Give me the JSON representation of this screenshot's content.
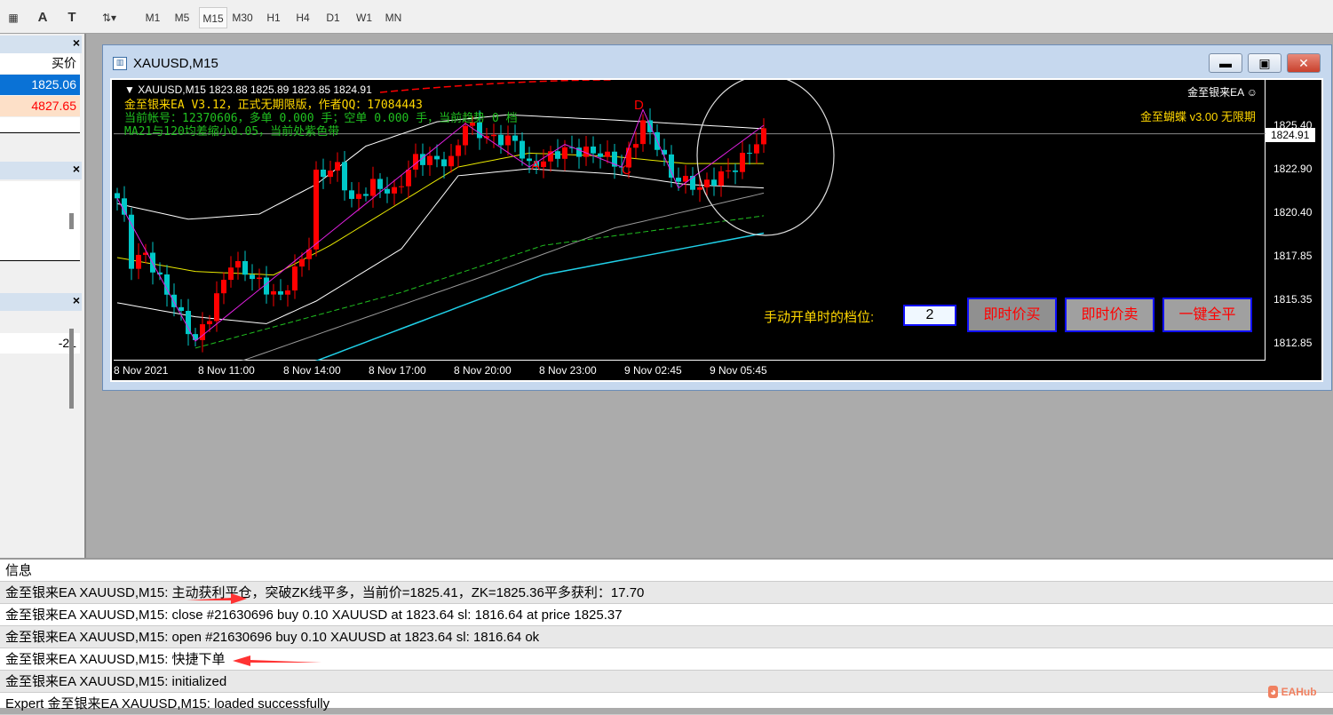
{
  "toolbar": {
    "timeframes": [
      "M1",
      "M5",
      "M15",
      "M30",
      "H1",
      "H4",
      "D1",
      "W1",
      "MN"
    ],
    "active": "M15"
  },
  "market_watch": {
    "header": "买价",
    "rows": [
      "1825.06",
      "4827.65"
    ]
  },
  "left_panel3": {
    "value": "-21"
  },
  "window": {
    "title": "XAUUSD,M15"
  },
  "chart": {
    "header": "XAUUSD,M15  1823.88 1825.89 1823.85 1824.91",
    "info_lines": [
      "金至银来EA V3.12，正式无期限版，作者QQ：17084443",
      "当前帐号：12370606，多单 0.000 手；空单 0.000 手，当前趋势 0 档",
      "MA21与120均差缩小0.05，当前处紫色带"
    ],
    "ea_name": "金至银来EA ☺",
    "ea_sub": "金至蝴蝶 v3.00 无限期",
    "current_price": "1824.91",
    "price_labels": [
      "1825.40",
      "1822.90",
      "1820.40",
      "1817.85",
      "1815.35",
      "1812.85"
    ],
    "time_labels": [
      "8 Nov 2021",
      "8 Nov 11:00",
      "8 Nov 14:00",
      "8 Nov 17:00",
      "8 Nov 20:00",
      "8 Nov 23:00",
      "9 Nov 02:45",
      "9 Nov 05:45"
    ],
    "pattern_labels": [
      "A",
      "C",
      "D"
    ],
    "manual_level_label": "手动开单时的档位:",
    "manual_level_value": "2",
    "buttons": [
      "即时价买",
      "即时价卖",
      "一键全平"
    ],
    "colors": {
      "bull": "#ff0000",
      "bear": "#00c8c8",
      "zigzag": "#e020e0",
      "ma": "#e8e800"
    }
  },
  "chart_data": {
    "type": "candlestick",
    "symbol": "XAUUSD",
    "timeframe": "M15",
    "ylim": [
      1811.0,
      1828.0
    ],
    "close_keypoints": [
      [
        0,
        1821.2
      ],
      [
        1,
        1820
      ],
      [
        2,
        1817.5
      ],
      [
        4,
        1818
      ],
      [
        6,
        1816.5
      ],
      [
        11,
        1813
      ],
      [
        13,
        1814.5
      ],
      [
        16,
        1817.5
      ],
      [
        18,
        1817
      ],
      [
        21,
        1816
      ],
      [
        23,
        1815.5
      ],
      [
        27,
        1818.5
      ],
      [
        28,
        1822.5
      ],
      [
        31,
        1823
      ],
      [
        33,
        1821
      ],
      [
        36,
        1822
      ],
      [
        39,
        1821.5
      ],
      [
        42,
        1823.5
      ],
      [
        47,
        1823.3
      ],
      [
        49,
        1825.5
      ],
      [
        52,
        1824.7
      ],
      [
        56,
        1824.5
      ],
      [
        58,
        1823
      ],
      [
        63,
        1824
      ],
      [
        68,
        1823.8
      ],
      [
        71,
        1823
      ],
      [
        74,
        1825.5
      ],
      [
        76,
        1824.3
      ],
      [
        78,
        1822.5
      ],
      [
        82,
        1821.8
      ],
      [
        87,
        1823
      ],
      [
        91,
        1824.9
      ]
    ],
    "upper_band": [
      [
        0,
        1820.9
      ],
      [
        10,
        1820.0
      ],
      [
        20,
        1820.3
      ],
      [
        28,
        1822.0
      ],
      [
        35,
        1824.2
      ],
      [
        45,
        1825.6
      ],
      [
        55,
        1826.0
      ],
      [
        70,
        1825.7
      ],
      [
        91,
        1825.2
      ]
    ],
    "lower_band": [
      [
        0,
        1815.2
      ],
      [
        11,
        1814.4
      ],
      [
        21,
        1814.0
      ],
      [
        28,
        1815.3
      ],
      [
        40,
        1818.3
      ],
      [
        48,
        1822.5
      ],
      [
        58,
        1822.9
      ],
      [
        70,
        1822.6
      ],
      [
        80,
        1822.0
      ],
      [
        91,
        1821.8
      ]
    ],
    "ma": [
      [
        0,
        1817.8
      ],
      [
        11,
        1817.0
      ],
      [
        22,
        1816.8
      ],
      [
        30,
        1818.5
      ],
      [
        40,
        1821.0
      ],
      [
        48,
        1823.0
      ],
      [
        58,
        1823.8
      ],
      [
        70,
        1823.6
      ],
      [
        80,
        1823.2
      ],
      [
        91,
        1823.2
      ]
    ],
    "ma_green": [
      [
        11,
        1812.6
      ],
      [
        40,
        1815.8
      ],
      [
        60,
        1818.5
      ],
      [
        91,
        1820.2
      ]
    ],
    "ma_gray": [
      [
        15,
        1811.5
      ],
      [
        50,
        1816.5
      ],
      [
        70,
        1819.5
      ],
      [
        91,
        1821.5
      ]
    ],
    "ma_cyan": [
      [
        25,
        1811.4
      ],
      [
        60,
        1816.8
      ],
      [
        91,
        1819.2
      ]
    ],
    "zigzag": [
      [
        0,
        1821.2
      ],
      [
        11,
        1813
      ],
      [
        49,
        1825.5
      ],
      [
        58,
        1823
      ],
      [
        63,
        1824.3
      ],
      [
        71,
        1823
      ],
      [
        74,
        1826.3
      ],
      [
        79,
        1821.8
      ],
      [
        91,
        1825.4
      ]
    ]
  },
  "log": {
    "header": "信息",
    "rows": [
      "金至银来EA XAUUSD,M15: 主动获利平仓，突破ZK线平多，当前价=1825.41，ZK=1825.36平多获利：17.70",
      "金至银来EA XAUUSD,M15: close #21630696 buy 0.10 XAUUSD at 1823.64 sl: 1816.64 at price 1825.37",
      "金至银来EA XAUUSD,M15: open #21630696 buy 0.10 XAUUSD at 1823.64 sl: 1816.64 ok",
      "金至银来EA XAUUSD,M15: 快捷下单",
      "金至银来EA XAUUSD,M15: initialized",
      "Expert 金至银来EA XAUUSD,M15: loaded successfully"
    ]
  },
  "watermark": "EAHub"
}
